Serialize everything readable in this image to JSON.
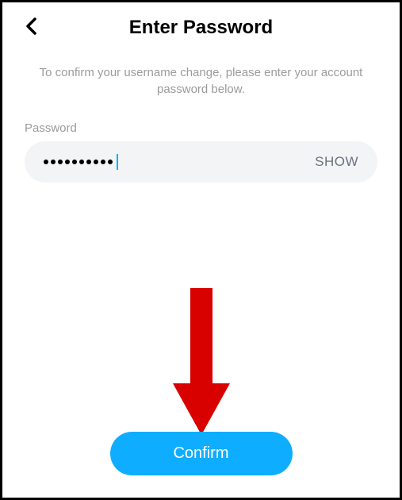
{
  "header": {
    "title": "Enter Password"
  },
  "description": {
    "text": "To confirm your username change, please enter your account password below."
  },
  "form": {
    "password_label": "Password",
    "show_label": "SHOW",
    "password_dots_count": 10
  },
  "actions": {
    "confirm_label": "Confirm"
  }
}
